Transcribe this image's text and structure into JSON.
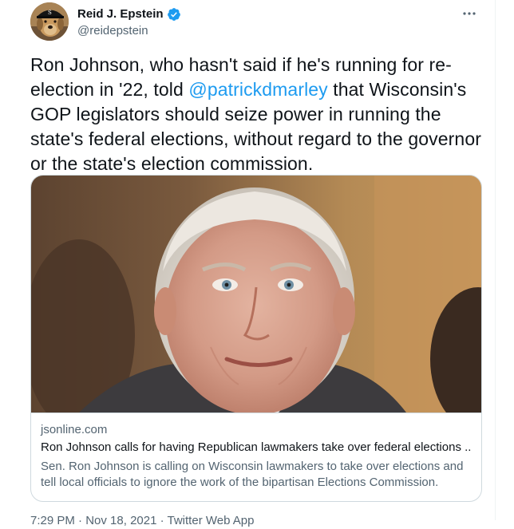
{
  "author": {
    "display_name": "Reid J. Epstein",
    "handle": "@reidepstein",
    "verified": true
  },
  "menu": {
    "more_icon": "more-horizontal-icon"
  },
  "tweet": {
    "text_before": "Ron Johnson, who hasn't said if he's running for re-election in '22, told ",
    "mention": "@patrickdmarley",
    "text_after": " that Wisconsin's GOP legislators should seize power in running the state's federal elections, without regard to the governor or the state's election commission."
  },
  "link_card": {
    "domain": "jsonline.com",
    "title": "Ron Johnson calls for having Republican lawmakers take over federal elections ...",
    "description": "Sen. Ron Johnson is calling on Wisconsin lawmakers to take over elections and tell local officials to ignore the work of the bipartisan Elections Commission."
  },
  "meta": {
    "time": "7:29 PM",
    "separator": " · ",
    "date": "Nov 18, 2021",
    "source": "Twitter Web App"
  },
  "colors": {
    "accent": "#1d9bf0",
    "secondary_text": "#536471",
    "border": "#cfd9de"
  }
}
